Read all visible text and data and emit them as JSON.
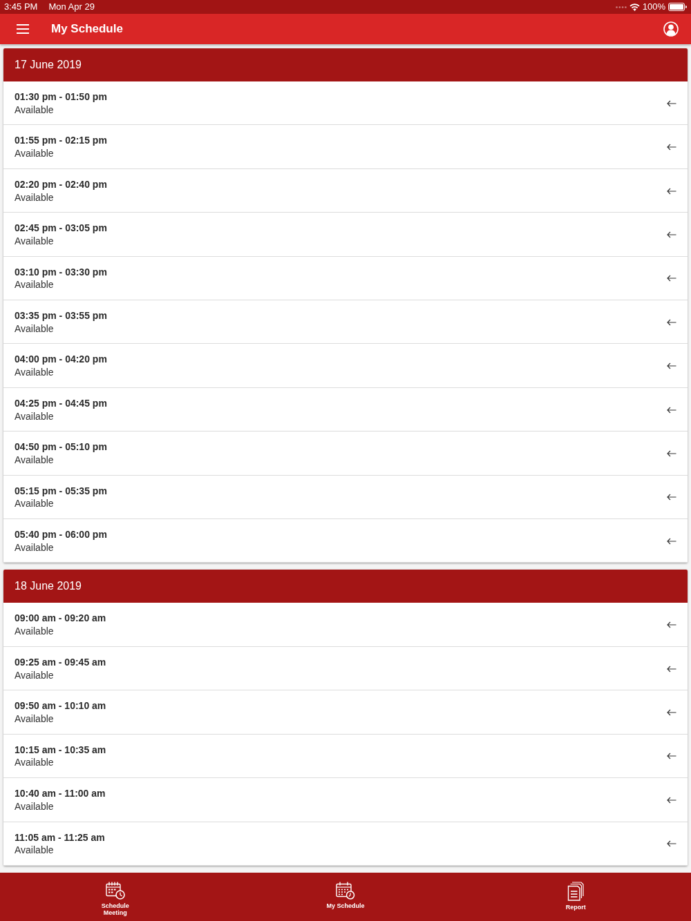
{
  "status_bar": {
    "time": "3:45 PM",
    "date": "Mon Apr 29",
    "battery": "100%"
  },
  "app_bar": {
    "title": "My Schedule"
  },
  "days": [
    {
      "date": "17 June 2019",
      "slots": [
        {
          "time": "01:30 pm - 01:50 pm",
          "status": "Available"
        },
        {
          "time": "01:55 pm - 02:15 pm",
          "status": "Available"
        },
        {
          "time": "02:20 pm - 02:40 pm",
          "status": "Available"
        },
        {
          "time": "02:45 pm - 03:05 pm",
          "status": "Available"
        },
        {
          "time": "03:10 pm - 03:30 pm",
          "status": "Available"
        },
        {
          "time": "03:35 pm - 03:55 pm",
          "status": "Available"
        },
        {
          "time": "04:00 pm - 04:20 pm",
          "status": "Available"
        },
        {
          "time": "04:25 pm - 04:45 pm",
          "status": "Available"
        },
        {
          "time": "04:50 pm - 05:10 pm",
          "status": "Available"
        },
        {
          "time": "05:15 pm - 05:35 pm",
          "status": "Available"
        },
        {
          "time": "05:40 pm - 06:00 pm",
          "status": "Available"
        }
      ]
    },
    {
      "date": "18 June 2019",
      "slots": [
        {
          "time": "09:00 am - 09:20 am",
          "status": "Available"
        },
        {
          "time": "09:25 am - 09:45 am",
          "status": "Available"
        },
        {
          "time": "09:50 am - 10:10 am",
          "status": "Available"
        },
        {
          "time": "10:15 am - 10:35 am",
          "status": "Available"
        },
        {
          "time": "10:40 am - 11:00 am",
          "status": "Available"
        },
        {
          "time": "11:05 am - 11:25 am",
          "status": "Available"
        }
      ]
    }
  ],
  "bottom_nav": [
    {
      "label": "Schedule Meeting"
    },
    {
      "label": "My Schedule"
    },
    {
      "label": "Report"
    }
  ]
}
